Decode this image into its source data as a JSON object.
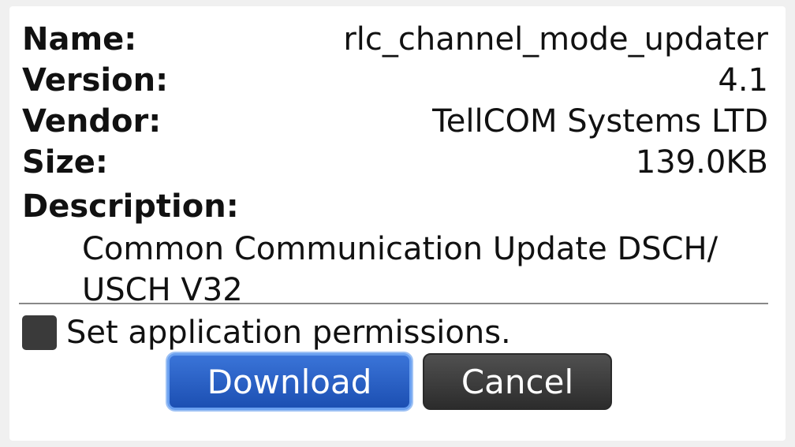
{
  "details": {
    "name_label": "Name:",
    "name_value": "rlc_channel_mode_updater",
    "version_label": "Version:",
    "version_value": "4.1",
    "vendor_label": "Vendor:",
    "vendor_value": "TellCOM Systems LTD",
    "size_label": "Size:",
    "size_value": "139.0KB",
    "description_label": "Description:",
    "description_line1": "Common Communication Update DSCH/",
    "description_line2": "USCH V32"
  },
  "permissions": {
    "checkbox_label": "Set application permissions.",
    "checked": false
  },
  "buttons": {
    "download_label": "Download",
    "cancel_label": "Cancel"
  },
  "colors": {
    "download_button": "#2a62c8",
    "cancel_button": "#3e3e3e",
    "checkbox": "#3a3a3a"
  }
}
